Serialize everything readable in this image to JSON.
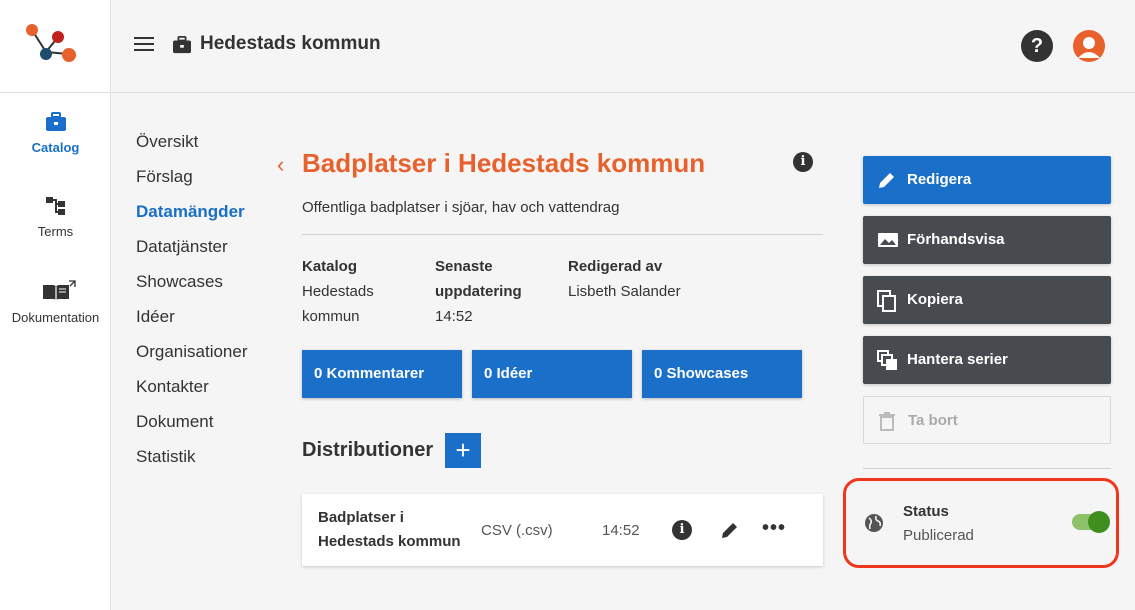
{
  "rail": {
    "items": [
      {
        "label": "Catalog",
        "icon": "briefcase-icon"
      },
      {
        "label": "Terms",
        "icon": "hierarchy-icon"
      },
      {
        "label": "Dokumentation",
        "icon": "book-icon"
      }
    ]
  },
  "header": {
    "title": "Hedestads kommun",
    "help": "?"
  },
  "subnav": {
    "items": [
      "Översikt",
      "Förslag",
      "Datamängder",
      "Datatjänster",
      "Showcases",
      "Idéer",
      "Organisationer",
      "Kontakter",
      "Dokument",
      "Statistik"
    ],
    "active_index": 2
  },
  "dataset": {
    "back": "‹",
    "title": "Badplatser i Hedestads kommun",
    "description": "Offentliga badplatser i sjöar, hav och vattendrag",
    "meta": {
      "catalog_label": "Katalog",
      "catalog_value_1": "Hedestads",
      "catalog_value_2": "kommun",
      "updated_label_1": "Senaste",
      "updated_label_2": "uppdatering",
      "updated_value": "14:52",
      "edited_label": "Redigerad av",
      "edited_value": "Lisbeth Salander"
    },
    "stats": {
      "comments": "0 Kommentarer",
      "ideas": "0 Idéer",
      "showcases": "0 Showcases"
    }
  },
  "distributions": {
    "heading": "Distributioner",
    "add_label": "+",
    "items": [
      {
        "name_1": "Badplatser i",
        "name_2": "Hedestads kommun",
        "format": "CSV (.csv)",
        "time": "14:52"
      }
    ],
    "more": "•••"
  },
  "actions": {
    "edit": "Redigera",
    "preview": "Förhandsvisa",
    "copy": "Kopiera",
    "series": "Hantera serier",
    "delete": "Ta bort"
  },
  "status": {
    "label": "Status",
    "value": "Publicerad",
    "published": true
  },
  "colors": {
    "accent": "#1a6fc9",
    "brand": "#e8612c",
    "highlight": "#f0361c"
  }
}
